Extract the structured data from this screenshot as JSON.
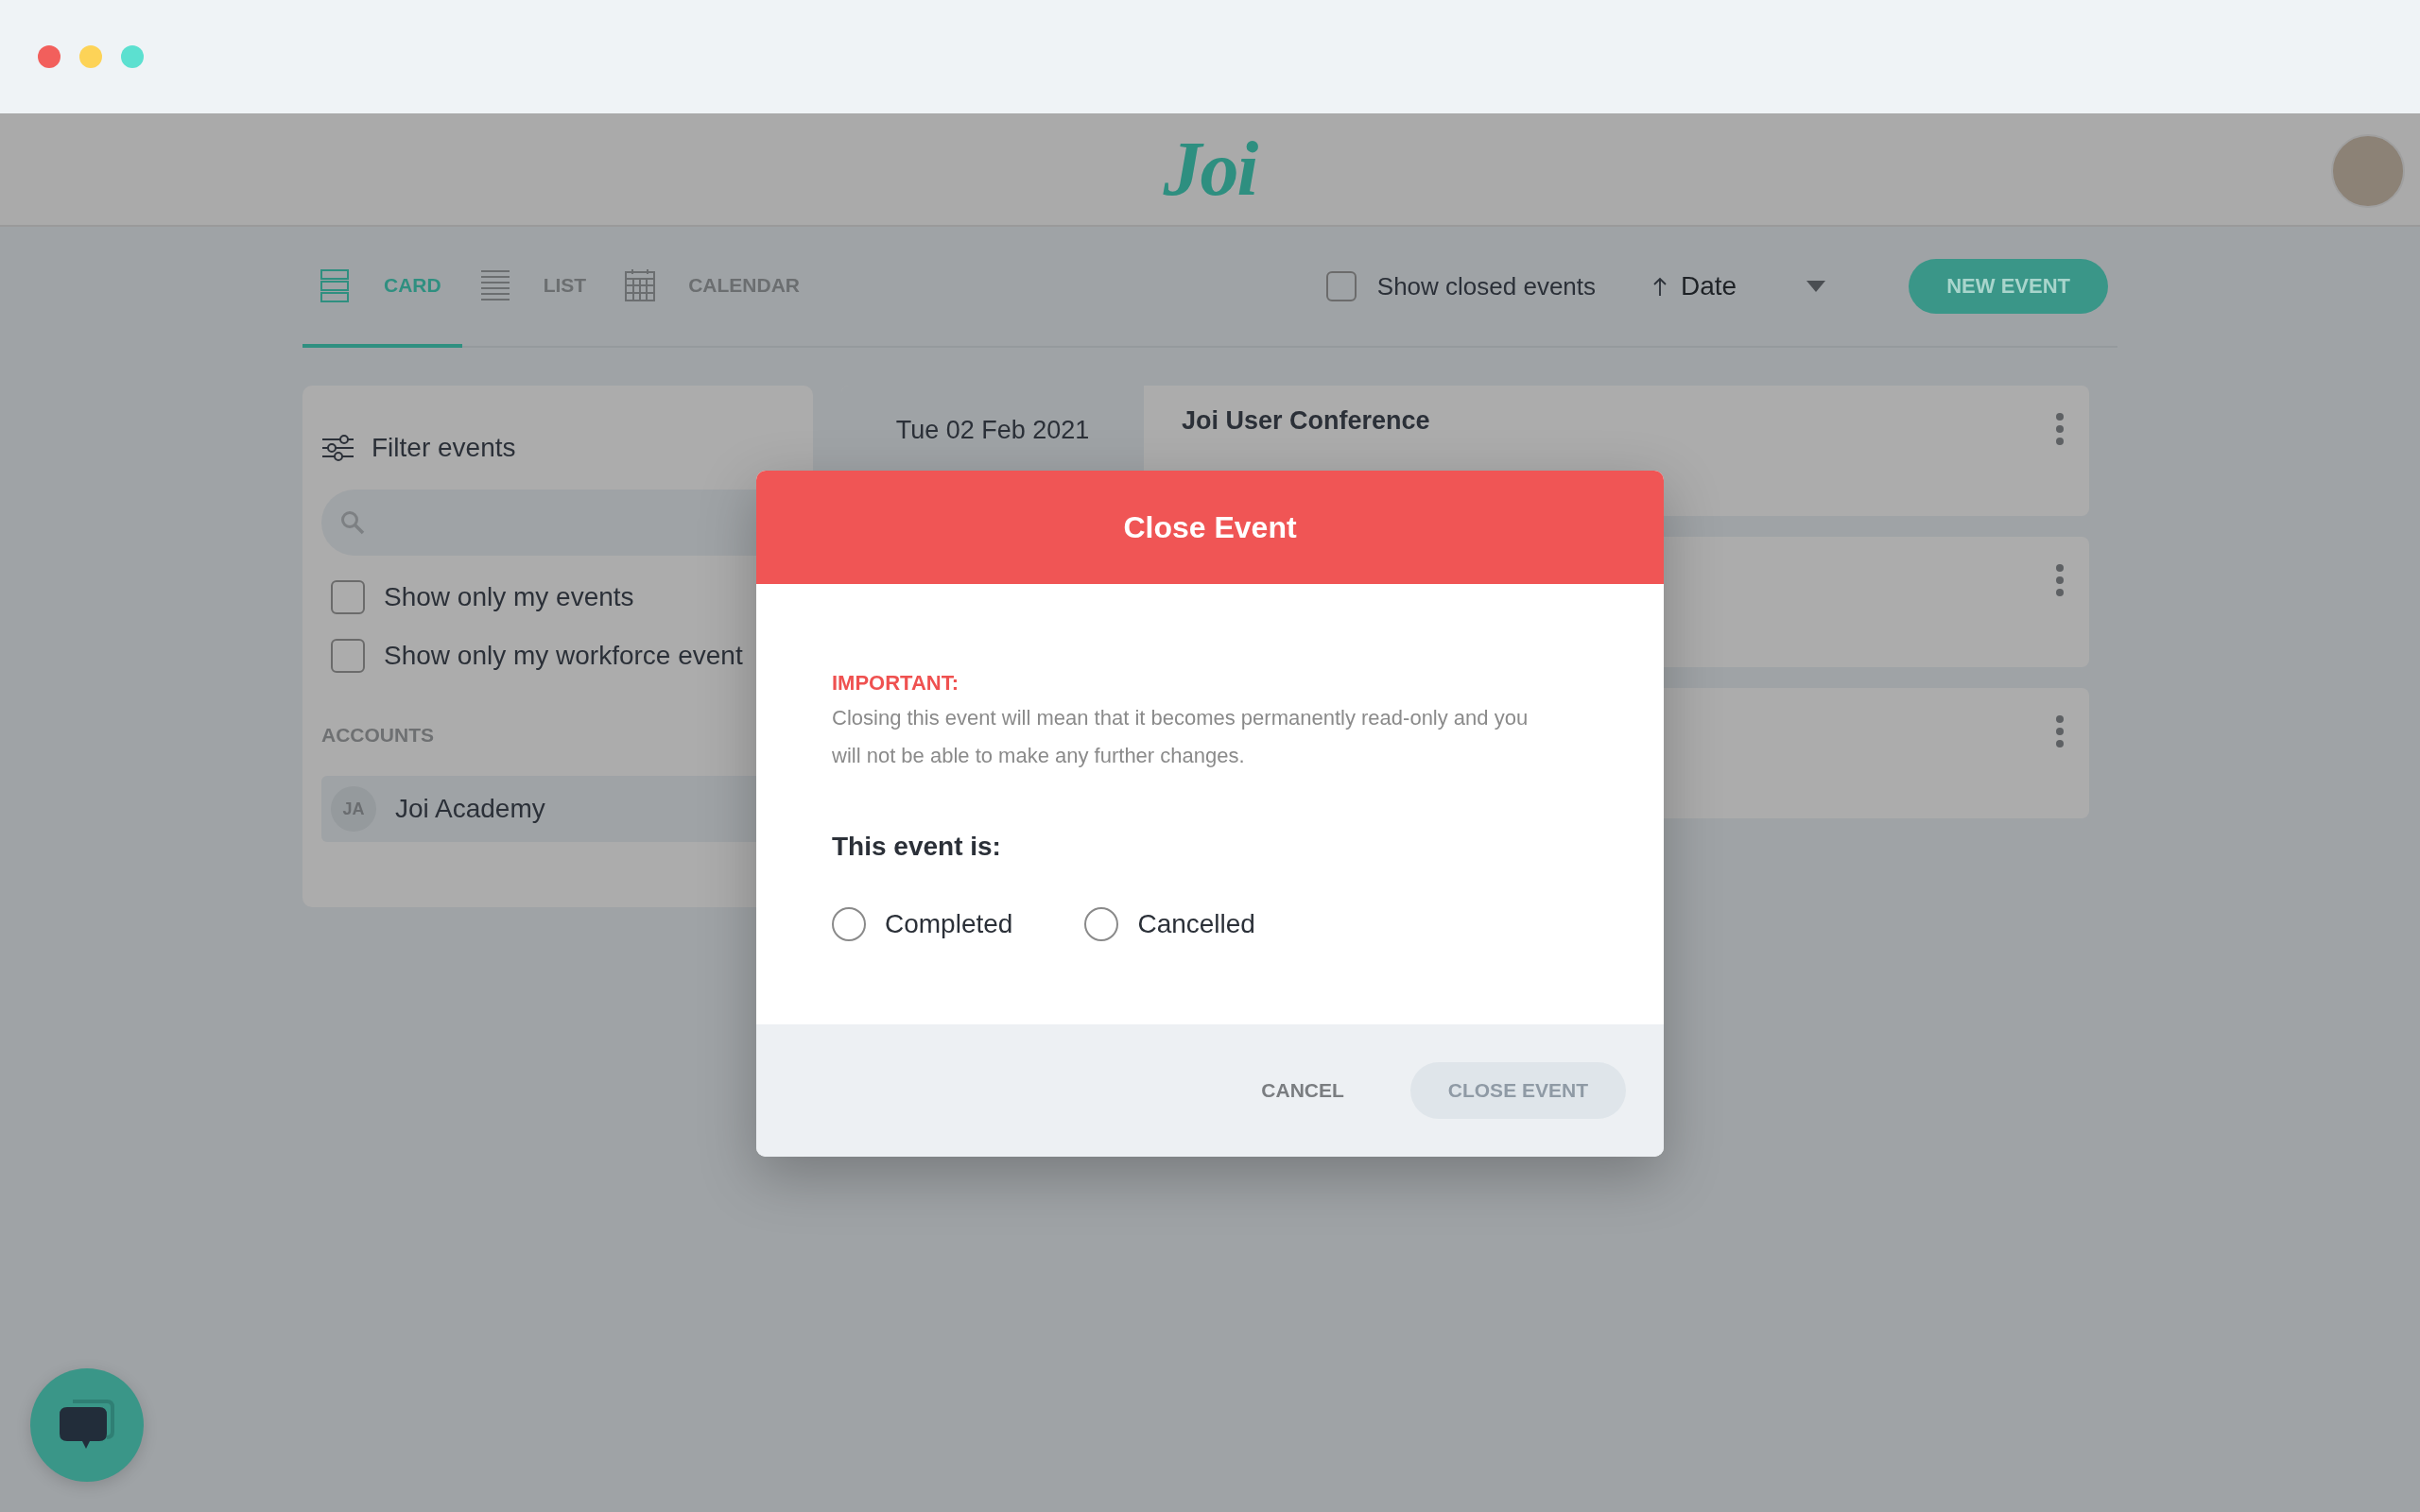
{
  "window": {
    "controls": [
      {
        "color": "#f25f5c"
      },
      {
        "color": "#fdd357"
      },
      {
        "color": "#5ce0d0"
      }
    ]
  },
  "header": {
    "logo": "Joi"
  },
  "view_tabs": [
    {
      "label": "CARD",
      "kind": "card",
      "selected": true
    },
    {
      "label": "LIST",
      "kind": "list",
      "selected": false
    },
    {
      "label": "CALENDAR",
      "kind": "calendar",
      "selected": false
    }
  ],
  "toolbar": {
    "show_closed": {
      "label": "Show closed events",
      "checked": false
    },
    "sort": {
      "label": "Date"
    },
    "new_event_button": "NEW EVENT"
  },
  "filter_panel": {
    "title": "Filter events",
    "options": [
      {
        "label": "Show only my events",
        "checked": false
      },
      {
        "label": "Show only my workforce event",
        "checked": false
      }
    ],
    "accounts_heading": "ACCOUNTS",
    "accounts": [
      {
        "initials": "JA",
        "name": "Joi Academy",
        "selected": true
      }
    ]
  },
  "events": [
    {
      "kind": "visible",
      "date": "Tue 02 Feb 2021",
      "title": "Joi User Conference"
    },
    {
      "kind": "covered"
    },
    {
      "kind": "covered"
    }
  ],
  "dialog": {
    "title": "Close Event",
    "notice_label": "IMPORTANT:",
    "notice": "Closing this event will mean that it becomes permanently read-only and you will not be able to make any further changes.",
    "question": "This event is:",
    "options": [
      {
        "label": "Completed",
        "selected": false
      },
      {
        "label": "Cancelled",
        "selected": false
      }
    ],
    "buttons": [
      {
        "label": "CANCEL",
        "kind": "text",
        "disabled": false
      },
      {
        "label": "CLOSE EVENT",
        "kind": "filled",
        "disabled": true
      }
    ]
  }
}
